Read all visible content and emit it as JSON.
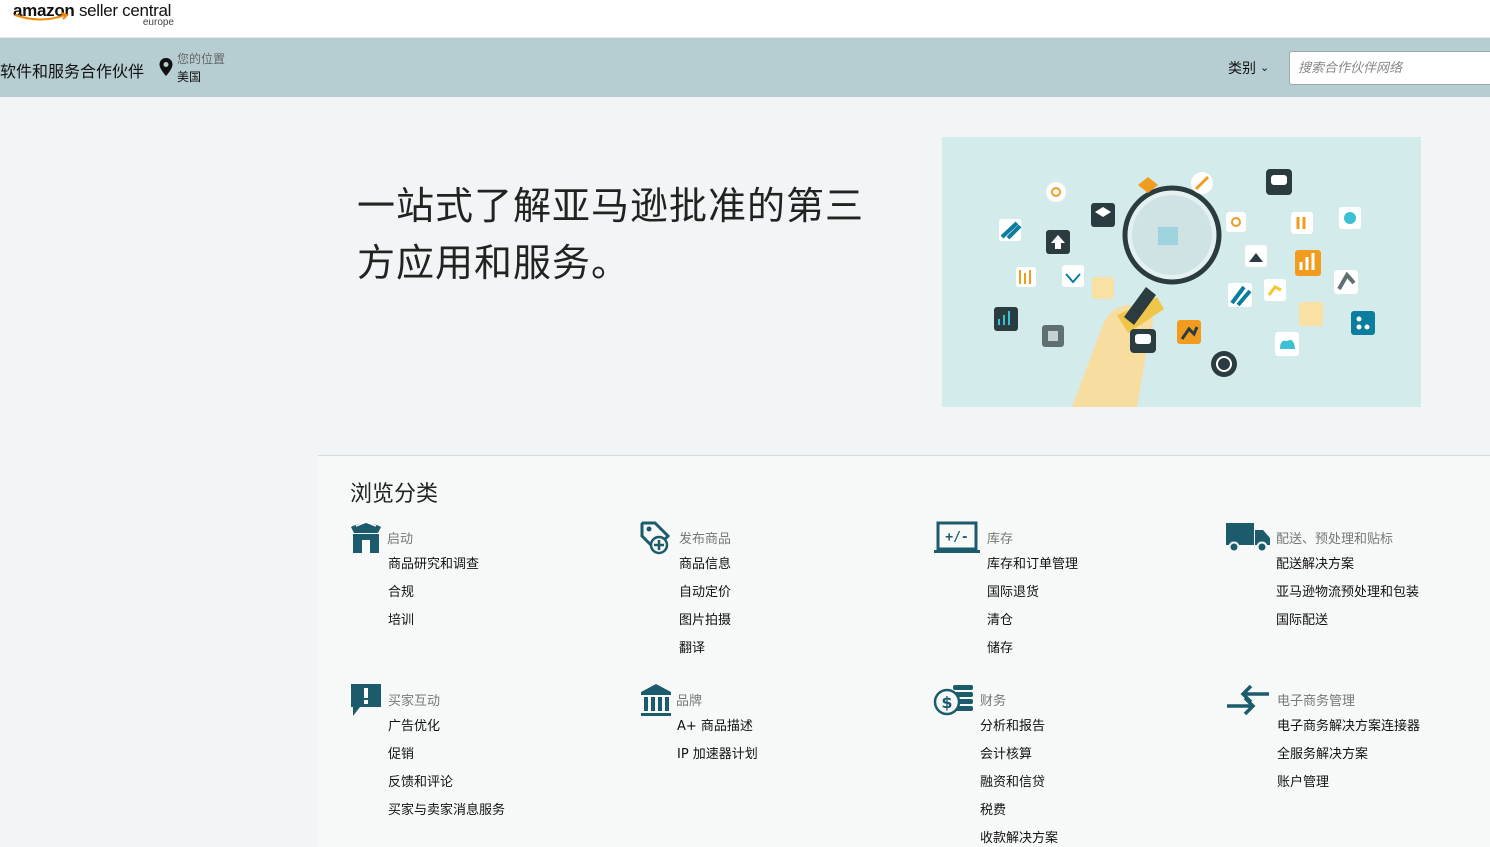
{
  "header": {
    "logo_brand": "amazon",
    "logo_product": "seller central",
    "logo_region": "europe"
  },
  "nav": {
    "title": "软件和服务合作伙伴",
    "location_label": "您的位置",
    "location_value": "美国",
    "category_label": "类别",
    "search_placeholder": "搜索合作伙伴网络"
  },
  "hero": {
    "title": "一站式了解亚马逊批准的第三方应用和服务。"
  },
  "browse": {
    "title": "浏览分类",
    "categories": [
      {
        "name": "启动",
        "icon": "store-icon",
        "items": [
          "商品研究和调查",
          "合规",
          "培训"
        ]
      },
      {
        "name": "发布商品",
        "icon": "tag-add-icon",
        "items": [
          "商品信息",
          "自动定价",
          "图片拍摄",
          "翻译"
        ]
      },
      {
        "name": "库存",
        "icon": "inventory-laptop-icon",
        "items": [
          "库存和订单管理",
          "国际退货",
          "清仓",
          "储存"
        ]
      },
      {
        "name": "配送、预处理和贴标",
        "icon": "truck-icon",
        "items": [
          "配送解决方案",
          "亚马逊物流预处理和包装",
          "国际配送"
        ]
      },
      {
        "name": "买家互动",
        "icon": "chat-alert-icon",
        "items": [
          "广告优化",
          "促销",
          "反馈和评论",
          "买家与卖家消息服务"
        ]
      },
      {
        "name": "品牌",
        "icon": "bank-icon",
        "items": [
          "A+ 商品描述",
          "IP 加速器计划"
        ]
      },
      {
        "name": "财务",
        "icon": "dollar-coins-icon",
        "items": [
          "分析和报告",
          "会计核算",
          "融资和信贷",
          "税费",
          "收款解决方案"
        ]
      },
      {
        "name": "电子商务管理",
        "icon": "exchange-arrows-icon",
        "items": [
          "电子商务解决方案连接器",
          "全服务解决方案",
          "账户管理"
        ]
      }
    ]
  },
  "colors": {
    "navbar": "#b6ced2",
    "icon_teal": "#1c5b6b",
    "hero_illustration_bg": "#d3eceb"
  }
}
